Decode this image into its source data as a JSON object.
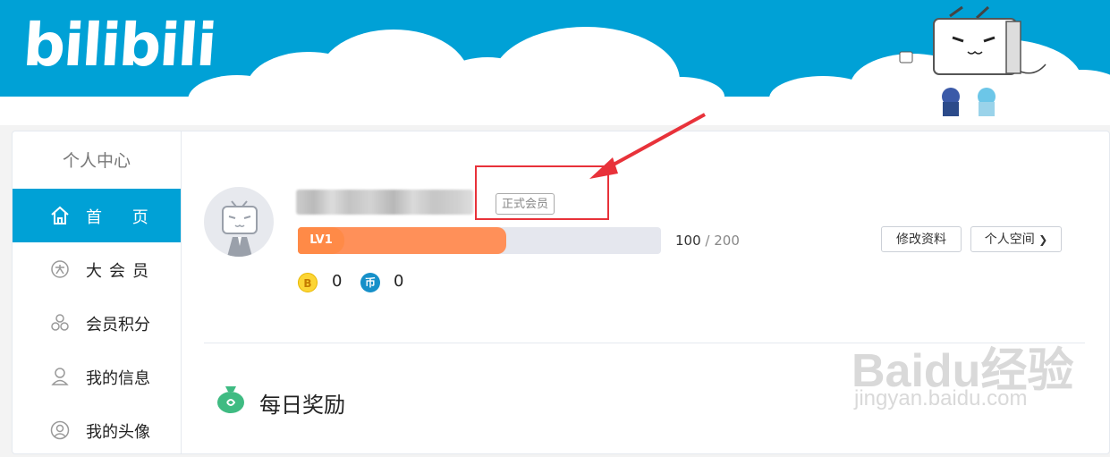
{
  "header": {
    "logo_text": "bilibili",
    "colors": {
      "sky": "#00a1d6",
      "cloud": "#ffffff"
    }
  },
  "sidebar": {
    "title": "个人中心",
    "items": [
      {
        "label": "首 页",
        "icon": "home-icon",
        "active": true
      },
      {
        "label": "大会员",
        "icon": "vip-icon",
        "active": false
      },
      {
        "label": "会员积分",
        "icon": "points-icon",
        "active": false
      },
      {
        "label": "我的信息",
        "icon": "user-info-icon",
        "active": false
      },
      {
        "label": "我的头像",
        "icon": "avatar-icon",
        "active": false
      }
    ]
  },
  "profile": {
    "member_badge": "正式会员",
    "level_label": "LV1",
    "exp_current": "100",
    "exp_separator": "/",
    "exp_max": "200",
    "exp_fraction": 0.5,
    "coins": [
      {
        "icon": "b-coin-icon",
        "glyph": "B",
        "value": "0"
      },
      {
        "icon": "hard-coin-icon",
        "glyph": "币",
        "value": "0"
      }
    ],
    "edit_button": "修改资料",
    "space_button": "个人空间",
    "space_chevron": "❯"
  },
  "daily_reward": {
    "title": "每日奖励"
  },
  "watermark": {
    "brand": "Baidu经验",
    "url": "jingyan.baidu.com"
  },
  "colors": {
    "accent": "#00a1d6",
    "level": "#ff9059",
    "annotation": "#e8323a"
  }
}
